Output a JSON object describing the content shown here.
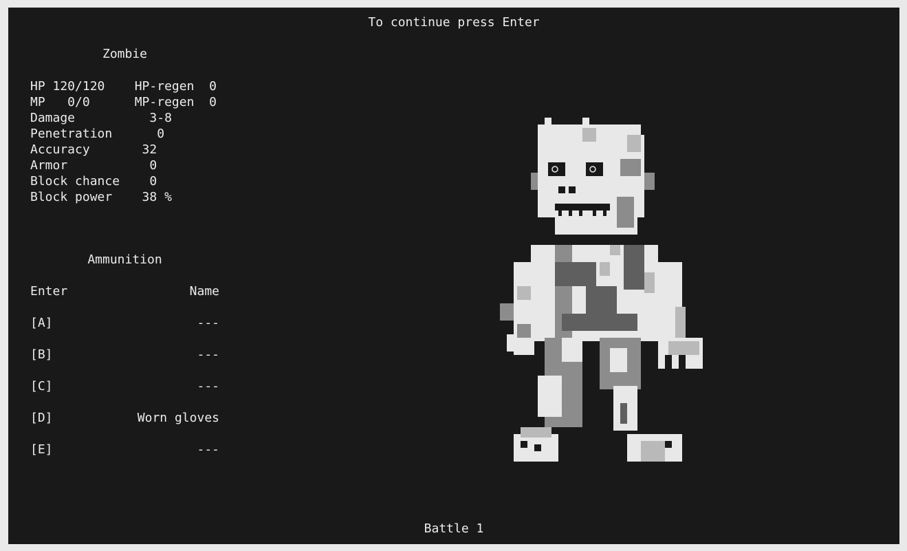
{
  "header": {
    "prompt": "To continue press Enter"
  },
  "monster": {
    "name": "Zombie",
    "stats": [
      "HP 120/120    HP-regen  0",
      "MP   0/0      MP-regen  0",
      "Damage          3-8",
      "Penetration      0",
      "Accuracy       32",
      "Armor           0",
      "Block chance    0",
      "Block power    38 %"
    ]
  },
  "ammunition": {
    "title": "Ammunition",
    "col_enter": "Enter",
    "col_name": "Name",
    "slots": [
      {
        "key": "[A]",
        "name": "---"
      },
      {
        "key": "[B]",
        "name": "---"
      },
      {
        "key": "[C]",
        "name": "---"
      },
      {
        "key": "[D]",
        "name": "Worn gloves"
      },
      {
        "key": "[E]",
        "name": "---"
      }
    ]
  },
  "footer": {
    "battle": "Battle 1"
  },
  "colors": {
    "background": "#191919",
    "page": "#e9e9e9",
    "text": "#ececec",
    "sprite_light": "#e8e8e8",
    "sprite_mid": "#b9b9b9",
    "sprite_dark": "#8c8c8c",
    "sprite_darker": "#5f5f5f"
  }
}
